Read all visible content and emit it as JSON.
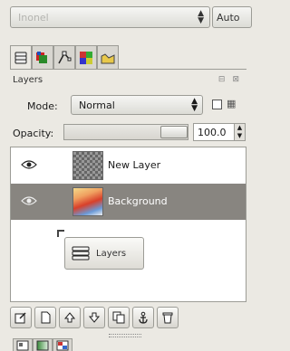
{
  "image_selector": {
    "value": "Inonel",
    "auto_label": "Auto"
  },
  "dock_tabs": [
    {
      "icon": "layers-tab-icon",
      "active": true
    },
    {
      "icon": "channels-tab-icon",
      "active": false
    },
    {
      "icon": "paths-tab-icon",
      "active": false
    },
    {
      "icon": "colormap-tab-icon",
      "active": false
    },
    {
      "icon": "histogram-tab-icon",
      "active": false
    }
  ],
  "layers_panel": {
    "title": "Layers",
    "mode_label": "Mode:",
    "mode_value": "Normal",
    "opacity_label": "Opacity:",
    "opacity_value": "100.0",
    "opacity_fraction": 1.0
  },
  "layers": [
    {
      "name": "New Layer",
      "visible": true,
      "selected": false,
      "thumb": "transparent"
    },
    {
      "name": "Background",
      "visible": true,
      "selected": true,
      "thumb": "image"
    }
  ],
  "drag_tooltip": {
    "label": "Layers"
  },
  "bottom_buttons": [
    {
      "icon": "edit-icon"
    },
    {
      "icon": "new-layer-icon"
    },
    {
      "icon": "raise-layer-icon"
    },
    {
      "icon": "lower-layer-icon"
    },
    {
      "icon": "duplicate-layer-icon"
    },
    {
      "icon": "anchor-icon"
    },
    {
      "icon": "delete-icon"
    }
  ],
  "bottom_dock_tabs": [
    {
      "icon": "tool-options-tab-icon"
    },
    {
      "icon": "gradient-tab-icon"
    },
    {
      "icon": "patterns-tab-icon"
    }
  ],
  "colors": {
    "selected_row": "#888580",
    "panel_bg": "#ebe9e3"
  }
}
